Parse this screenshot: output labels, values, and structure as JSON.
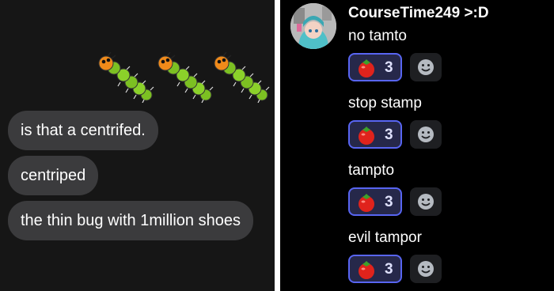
{
  "left_chat": {
    "emoji": [
      "centipede-emoji",
      "centipede-emoji",
      "centipede-emoji"
    ],
    "bubbles": [
      "is that a centrifed.",
      "centriped",
      "the thin bug with 1million shoes"
    ]
  },
  "right_chat": {
    "username": "CourseTime249 >:D",
    "messages": [
      {
        "text": "no tamto",
        "reaction": {
          "emoji": "tomato",
          "count": "3"
        }
      },
      {
        "text": "stop stamp",
        "reaction": {
          "emoji": "tomato",
          "count": "3"
        }
      },
      {
        "text": "tampto",
        "reaction": {
          "emoji": "tomato",
          "count": "3"
        }
      },
      {
        "text": "evil tampor",
        "reaction": {
          "emoji": "tomato",
          "count": "3"
        }
      }
    ],
    "colors": {
      "reaction_border": "#5865f2",
      "reaction_bg": "#26284a",
      "background": "#000000"
    }
  }
}
